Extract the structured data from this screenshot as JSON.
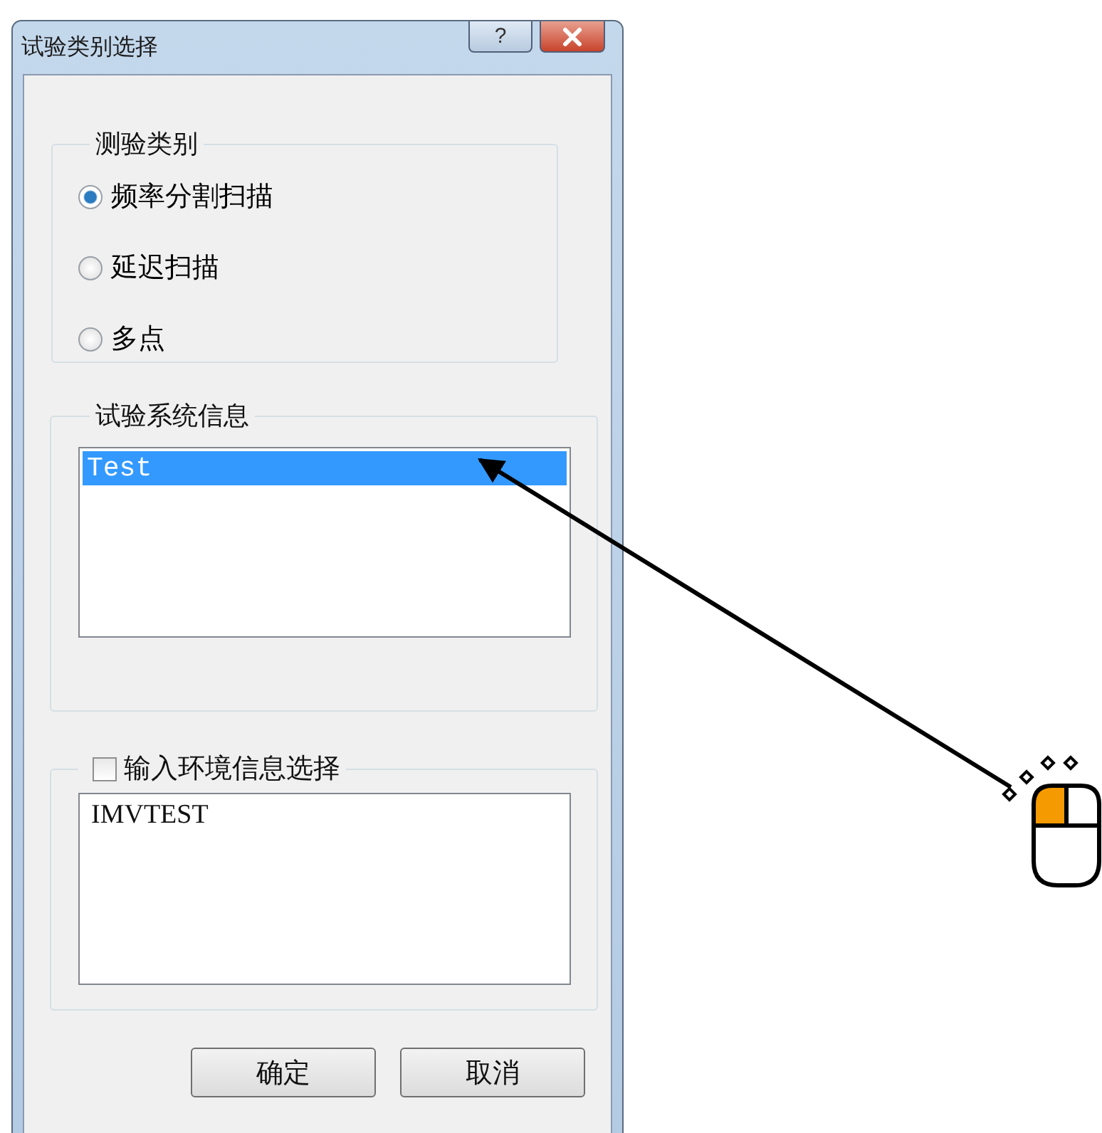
{
  "window": {
    "title": "试验类别选择",
    "help_button": "?"
  },
  "test_category": {
    "legend": "测验类别",
    "options": [
      {
        "label": "频率分割扫描",
        "selected": true
      },
      {
        "label": "延迟扫描",
        "selected": false
      },
      {
        "label": "多点",
        "selected": false
      }
    ]
  },
  "system_info": {
    "legend": "试验系统信息",
    "items": [
      {
        "label": "Test",
        "selected": true
      }
    ]
  },
  "environment": {
    "label": "输入环境信息选择",
    "checked": false,
    "text": "IMVTEST"
  },
  "buttons": [
    "确定",
    "取消"
  ]
}
